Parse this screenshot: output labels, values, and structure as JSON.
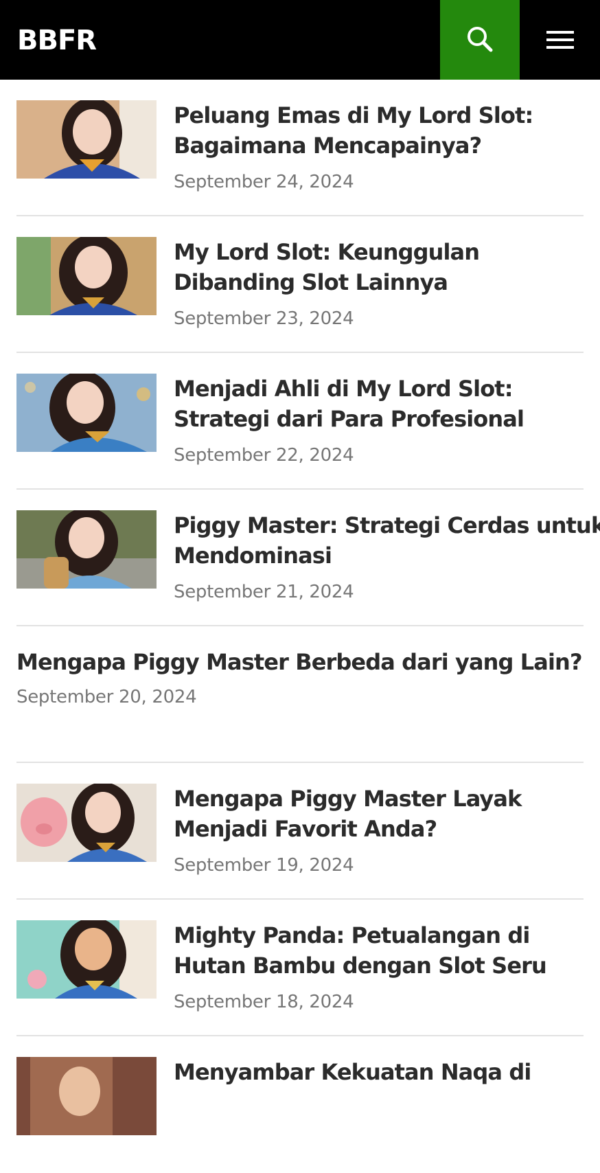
{
  "site": {
    "title": "BBFR",
    "accent_color": "#24890d",
    "header_bg": "#000000"
  },
  "header": {
    "search_icon": "search-icon",
    "menu_icon": "hamburger-menu-icon"
  },
  "posts": [
    {
      "title_line1": "Peluang Emas di My Lord Slot:",
      "title_line2": "Bagaimana Mencapainya?",
      "date": "September 24, 2024",
      "has_thumbnail": true,
      "thumb_palette": [
        "#d9b18a",
        "#2d4ea8",
        "#e6a030"
      ]
    },
    {
      "title_line1": "My Lord Slot: Keunggulan",
      "title_line2": "Dibanding Slot Lainnya",
      "date": "September 23, 2024",
      "has_thumbnail": true,
      "thumb_palette": [
        "#c9a36e",
        "#2b4fa6",
        "#d9a23a"
      ]
    },
    {
      "title_line1": "Menjadi Ahli di My Lord Slot:",
      "title_line2": "Strategi dari Para Profesional",
      "date": "September 22, 2024",
      "has_thumbnail": true,
      "thumb_palette": [
        "#8fb1cf",
        "#3a7fc4",
        "#d9a23a"
      ]
    },
    {
      "title_line1": "Piggy Master: Strategi Cerdas untuk",
      "title_line2": "Mendominasi",
      "date": "September 21, 2024",
      "has_thumbnail": true,
      "thumb_palette": [
        "#6e7a52",
        "#6fa7d6",
        "#c89a5a"
      ]
    },
    {
      "title_line1": "Mengapa Piggy Master Berbeda dari yang Lain?",
      "title_line2": "",
      "date": "September 20, 2024",
      "has_thumbnail": false
    },
    {
      "title_line1": "Mengapa Piggy Master Layak",
      "title_line2": "Menjadi Favorit Anda?",
      "date": "September 19, 2024",
      "has_thumbnail": true,
      "thumb_palette": [
        "#e8e0d6",
        "#3a6fc0",
        "#f0a0a8"
      ]
    },
    {
      "title_line1": "Mighty Panda: Petualangan di",
      "title_line2": "Hutan Bambu dengan Slot Seru",
      "date": "September 18, 2024",
      "has_thumbnail": true,
      "thumb_palette": [
        "#8fd3c8",
        "#3670c2",
        "#e9b48a"
      ]
    },
    {
      "title_line1": "Menyambar Kekuatan Naqa di",
      "title_line2": "",
      "date": "",
      "has_thumbnail": true,
      "thumb_palette": [
        "#7a4a3a",
        "#a06a50",
        "#e9c0a0"
      ]
    }
  ]
}
